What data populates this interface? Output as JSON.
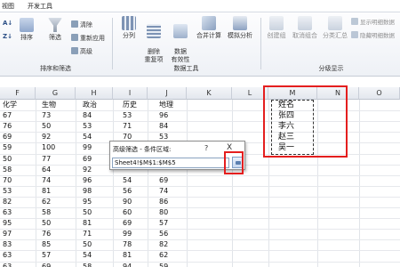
{
  "menu": {
    "left_item": "视图",
    "right_item": "开发工具"
  },
  "ribbon": {
    "sort_filter": {
      "sort_label": "排序",
      "filter_label": "筛选",
      "clear_label": "清除",
      "reapply_label": "重新应用",
      "advanced_label": "高级",
      "group_label": "排序和筛选"
    },
    "data_tools": {
      "split_label": "分列",
      "remove_dup_label": "删除\n重复项",
      "validation_label": "数据\n有效性",
      "consolidate_label": "合并计算",
      "whatif_label": "模拟分析",
      "group_label": "数据工具"
    },
    "outline": {
      "group_label_btn": "创建组",
      "ungroup_label": "取消组合",
      "subtotal_label": "分类汇总",
      "show_detail_label": "显示明细数据",
      "hide_detail_label": "隐藏明细数据",
      "group_label": "分级显示"
    }
  },
  "columns": [
    "F",
    "G",
    "H",
    "I",
    "J",
    "K",
    "L",
    "M",
    "N",
    "O"
  ],
  "header_row": [
    "化学",
    "生物",
    "政治",
    "历史",
    "地理"
  ],
  "rows": [
    [
      "67",
      "73",
      "84",
      "53",
      "96"
    ],
    [
      "76",
      "50",
      "53",
      "71",
      "84"
    ],
    [
      "69",
      "92",
      "54",
      "70",
      "53"
    ],
    [
      "59",
      "100",
      "99",
      "",
      ""
    ],
    [
      "50",
      "77",
      "69",
      "",
      ""
    ],
    [
      "58",
      "64",
      "92",
      "",
      ""
    ],
    [
      "70",
      "74",
      "96",
      "54",
      "69"
    ],
    [
      "53",
      "81",
      "98",
      "56",
      "74"
    ],
    [
      "82",
      "62",
      "95",
      "90",
      "86"
    ],
    [
      "63",
      "58",
      "50",
      "60",
      "80"
    ],
    [
      "95",
      "50",
      "81",
      "69",
      "57"
    ],
    [
      "97",
      "76",
      "71",
      "99",
      "56"
    ],
    [
      "83",
      "85",
      "50",
      "78",
      "82"
    ],
    [
      "63",
      "57",
      "54",
      "81",
      "62"
    ],
    [
      "63",
      "69",
      "58",
      "94",
      "59"
    ]
  ],
  "criteria": [
    "姓名",
    "张四",
    "李六",
    "赵三",
    "吴一"
  ],
  "dialog": {
    "title": "高级筛选 - 条件区域:",
    "help": "?",
    "close": "X",
    "range_value": "Sheet4!$M$1:$M$5"
  },
  "colors": {
    "highlight": "#e41e1e"
  }
}
